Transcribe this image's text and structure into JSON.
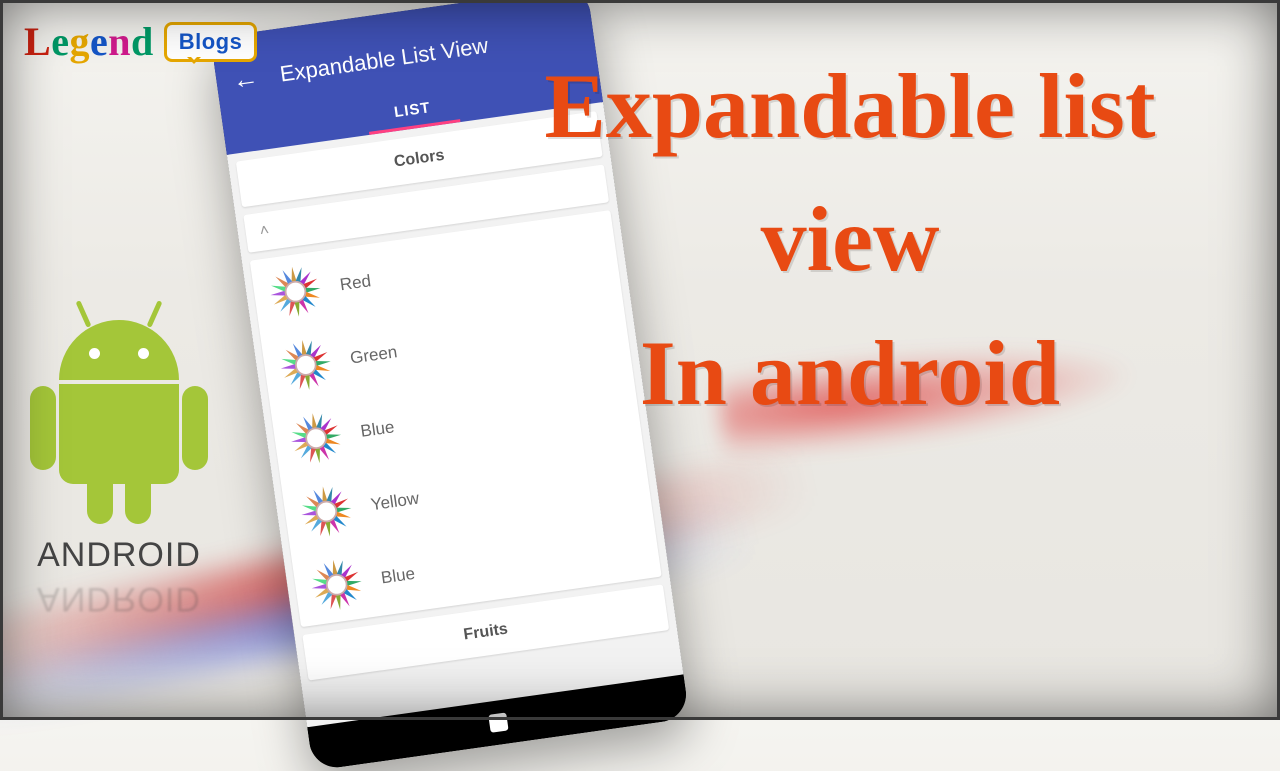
{
  "logo": {
    "word": {
      "l1": "L",
      "l2": "e",
      "l3": "g",
      "l4": "e",
      "l5": "n",
      "l6": "d"
    },
    "bubble": "Blogs"
  },
  "android": {
    "label": "ANDROID"
  },
  "headline": {
    "line1": "Expandable list",
    "line2": "view",
    "line3": "In android"
  },
  "phone": {
    "title": "Expandable List View",
    "tab": "LIST",
    "group_colors": "Colors",
    "chevron": "˄",
    "items": [
      "Red",
      "Green",
      "Blue",
      "Yellow",
      "Blue"
    ],
    "group_fruits": "Fruits"
  }
}
